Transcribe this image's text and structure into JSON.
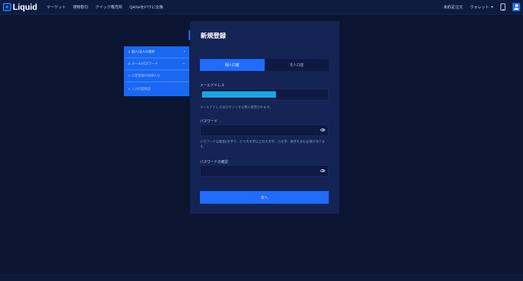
{
  "brand": {
    "name": "Liquid"
  },
  "nav": {
    "items": [
      "マーケット",
      "現物取引",
      "クイック販売所",
      "QASHをFTTに交換"
    ]
  },
  "right_nav": {
    "orders": "未約定注文",
    "wallet": "ウォレット"
  },
  "steps": [
    {
      "label": "1. 個人/法人の選択",
      "indicator": "›"
    },
    {
      "label": "2. メール/パスワード",
      "indicator": "–"
    },
    {
      "label": "3. 口座登録の詳細入力",
      "indicator": ""
    },
    {
      "label": "4. 入力内容確認",
      "indicator": ""
    }
  ],
  "form": {
    "title": "新規登録",
    "tabs": [
      "個人口座",
      "法人口座"
    ],
    "active_tab": "個人口座",
    "email_label": "メールアドレス",
    "email_help": "メールアドレスはログインする際に使用されます。",
    "password_label": "パスワード",
    "password_help": "パスワードは最低8文字で、かつ大文字以上の大文字、小文字、数字を含む必要があります。",
    "confirm_label": "パスワードの確認",
    "next_label": "次へ"
  },
  "colors": {
    "accent": "#1f6cff",
    "background": "#0b1531",
    "card": "#132455"
  }
}
